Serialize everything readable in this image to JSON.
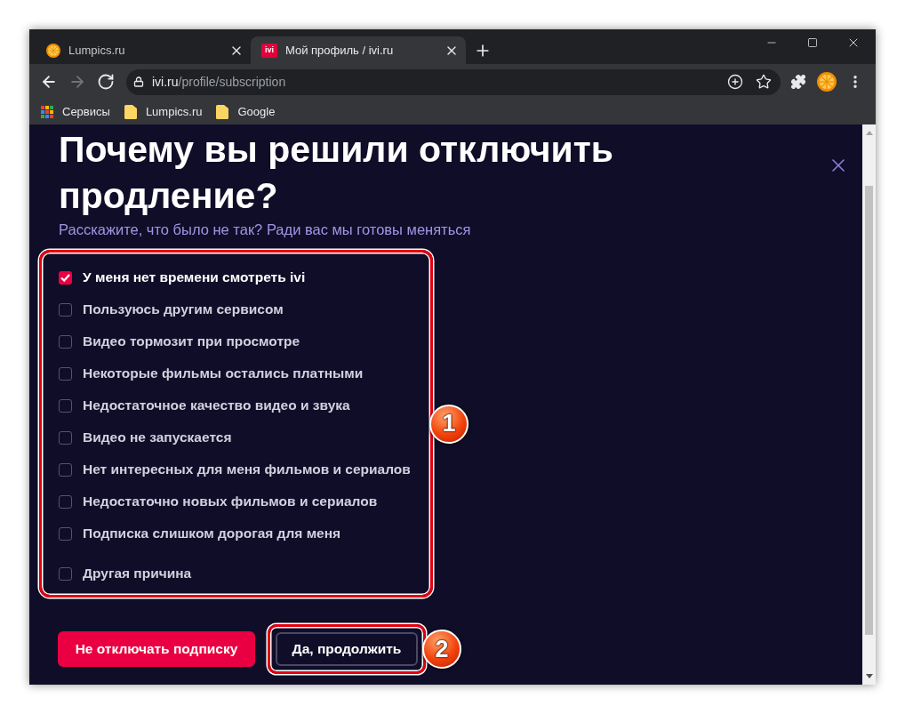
{
  "browser": {
    "tabs": [
      {
        "title": "Lumpics.ru",
        "selected": false,
        "favicon": {
          "kind": "orange"
        }
      },
      {
        "title": "Мой профиль / ivi.ru",
        "selected": true,
        "favicon": {
          "kind": "logo",
          "text": "ivi"
        }
      }
    ],
    "nav_buttons": [
      {
        "kind": "back",
        "disabled": false
      },
      {
        "kind": "forward",
        "disabled": true
      },
      {
        "kind": "reload",
        "disabled": false
      }
    ],
    "address": {
      "host": "ivi.ru",
      "path": "/profile/subscription"
    },
    "bookmarks": [
      {
        "label": "Сервисы",
        "kind": "apps"
      },
      {
        "label": "Lumpics.ru",
        "kind": "folder"
      },
      {
        "label": "Google",
        "kind": "folder"
      }
    ]
  },
  "dialog": {
    "title": "Почему вы решили отключить продление?",
    "subtitle": "Расскажите, что было не так? Ради вас мы готовы меняться",
    "reasons_marker": "1",
    "reasons": [
      {
        "label": "У меня нет времени смотреть ivi",
        "checked": true,
        "kind": "option"
      },
      {
        "label": "Пользуюсь другим сервисом",
        "checked": false,
        "kind": "option"
      },
      {
        "label": "Видео тормозит при просмотре",
        "checked": false,
        "kind": "option"
      },
      {
        "label": "Некоторые фильмы остались платными",
        "checked": false,
        "kind": "option"
      },
      {
        "label": "Недостаточное качество видео и звука",
        "checked": false,
        "kind": "option"
      },
      {
        "label": "Видео не запускается",
        "checked": false,
        "kind": "option"
      },
      {
        "label": "Нет интересных для меня фильмов и сериалов",
        "checked": false,
        "kind": "option"
      },
      {
        "label": "Недостаточно новых фильмов и сериалов",
        "checked": false,
        "kind": "option"
      },
      {
        "label": "Подписка слишком дорогая для меня",
        "checked": false,
        "kind": "option"
      },
      {
        "label": "Другая причина",
        "checked": false,
        "kind": "other"
      }
    ],
    "buttons": [
      {
        "label": "Не отключать подписку",
        "kind": "primary"
      },
      {
        "label": "Да, продолжить",
        "kind": "outline",
        "marker": "2"
      }
    ]
  }
}
